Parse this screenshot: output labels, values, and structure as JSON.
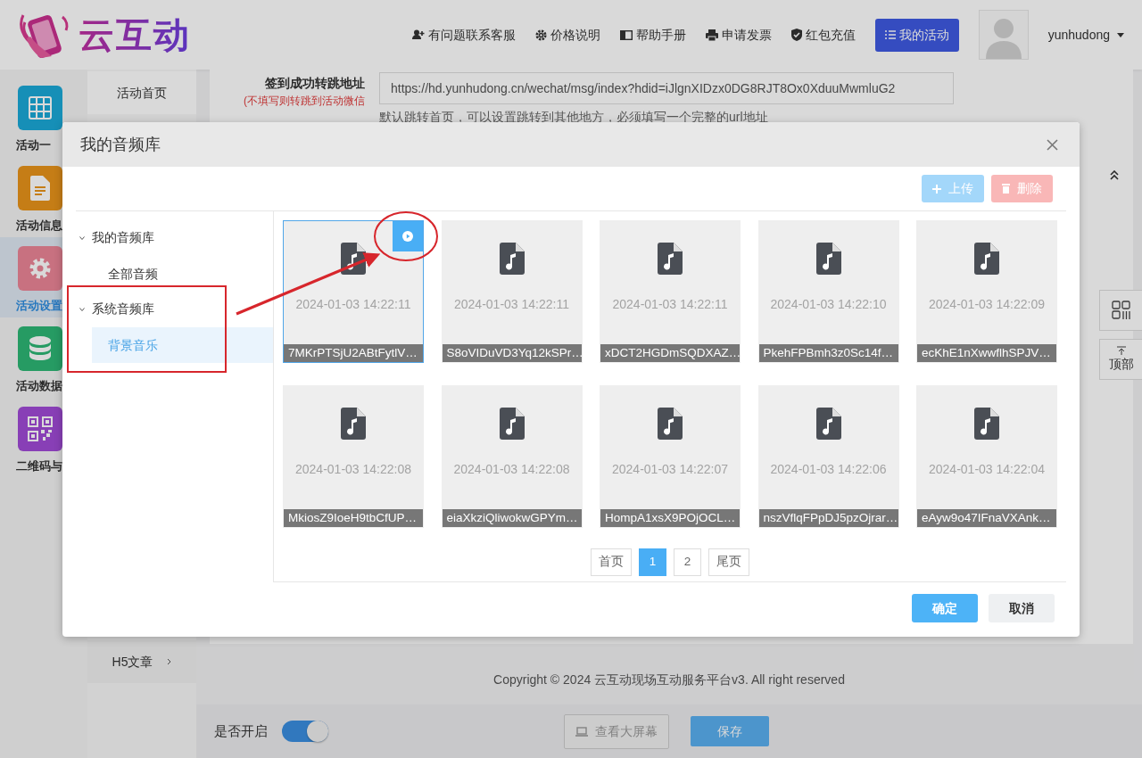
{
  "header": {
    "logo": "云互动",
    "links": [
      "有问题联系客服",
      "价格说明",
      "帮助手册",
      "申请发票",
      "红包充值"
    ],
    "primary_button": "我的活动",
    "username": "yunhudong"
  },
  "sidebar": {
    "items": [
      {
        "label": "活动一",
        "selected": false
      },
      {
        "label": "活动信息",
        "selected": false
      },
      {
        "label": "活动设置",
        "selected": true
      },
      {
        "label": "活动数据",
        "selected": false
      },
      {
        "label": "二维码与",
        "selected": false
      }
    ]
  },
  "subnav": {
    "items": [
      {
        "label": "活动首页",
        "has_submenu": false
      },
      {
        "label": "H5文章",
        "has_submenu": true
      }
    ]
  },
  "form": {
    "label": "签到成功转跳地址",
    "note": "(不填写则转跳到活动微信",
    "value": "https://hd.yunhudong.cn/wechat/msg/index?hdid=iJlgnXIDzx0DG8RJT8Ox0XduuMwmluG2",
    "hint": "默认跳转首页，可以设置跳转到其他地方，必须填写一个完整的url地址"
  },
  "footer": {
    "copyright": "Copyright © 2024 云互动现场互动服务平台v3. All right reserved"
  },
  "bottom_bar": {
    "toggle_label": "是否开启",
    "toggle_on": true,
    "preview_button": "查看大屏幕",
    "save_button": "保存"
  },
  "float_buttons": {
    "top_label": "顶部"
  },
  "modal": {
    "title": "我的音频库",
    "toolbar": [
      {
        "label": "上传",
        "kind": "upload",
        "disabled": true
      },
      {
        "label": "删除",
        "kind": "delete",
        "disabled": true
      }
    ],
    "tree": [
      {
        "label": "我的音频库",
        "expanded": true,
        "children": [
          {
            "label": "全部音频",
            "selected": false
          }
        ]
      },
      {
        "label": "系统音频库",
        "expanded": true,
        "children": [
          {
            "label": "背景音乐",
            "selected": true
          }
        ]
      }
    ],
    "files": [
      {
        "date": "2024-01-03 14:22:11",
        "name": "7MKrPTSjU2ABtFytlV…",
        "selected": true
      },
      {
        "date": "2024-01-03 14:22:11",
        "name": "S8oVIDuVD3Yq12kSPr…",
        "selected": false
      },
      {
        "date": "2024-01-03 14:22:11",
        "name": "xDCT2HGDmSQDXAZ…",
        "selected": false
      },
      {
        "date": "2024-01-03 14:22:10",
        "name": "PkehFPBmh3z0Sc14f…",
        "selected": false
      },
      {
        "date": "2024-01-03 14:22:09",
        "name": "ecKhE1nXwwflhSPJV…",
        "selected": false
      },
      {
        "date": "2024-01-03 14:22:08",
        "name": "MkiosZ9IoeH9tbCfUP…",
        "selected": false
      },
      {
        "date": "2024-01-03 14:22:08",
        "name": "eiaXkziQliwokwGPYm…",
        "selected": false
      },
      {
        "date": "2024-01-03 14:22:07",
        "name": "HompA1xsX9POjOCL…",
        "selected": false
      },
      {
        "date": "2024-01-03 14:22:06",
        "name": "nszVflqFPpDJ5pzOjrar…",
        "selected": false
      },
      {
        "date": "2024-01-03 14:22:04",
        "name": "eAyw9o47IFnaVXAnk…",
        "selected": false
      }
    ],
    "pagination": [
      {
        "label": "首页",
        "selected": false
      },
      {
        "label": "1",
        "selected": true
      },
      {
        "label": "2",
        "selected": false
      },
      {
        "label": "尾页",
        "selected": false
      }
    ],
    "buttons": [
      {
        "label": "确定",
        "kind": "primary"
      },
      {
        "label": "取消",
        "kind": "secondary"
      }
    ]
  }
}
